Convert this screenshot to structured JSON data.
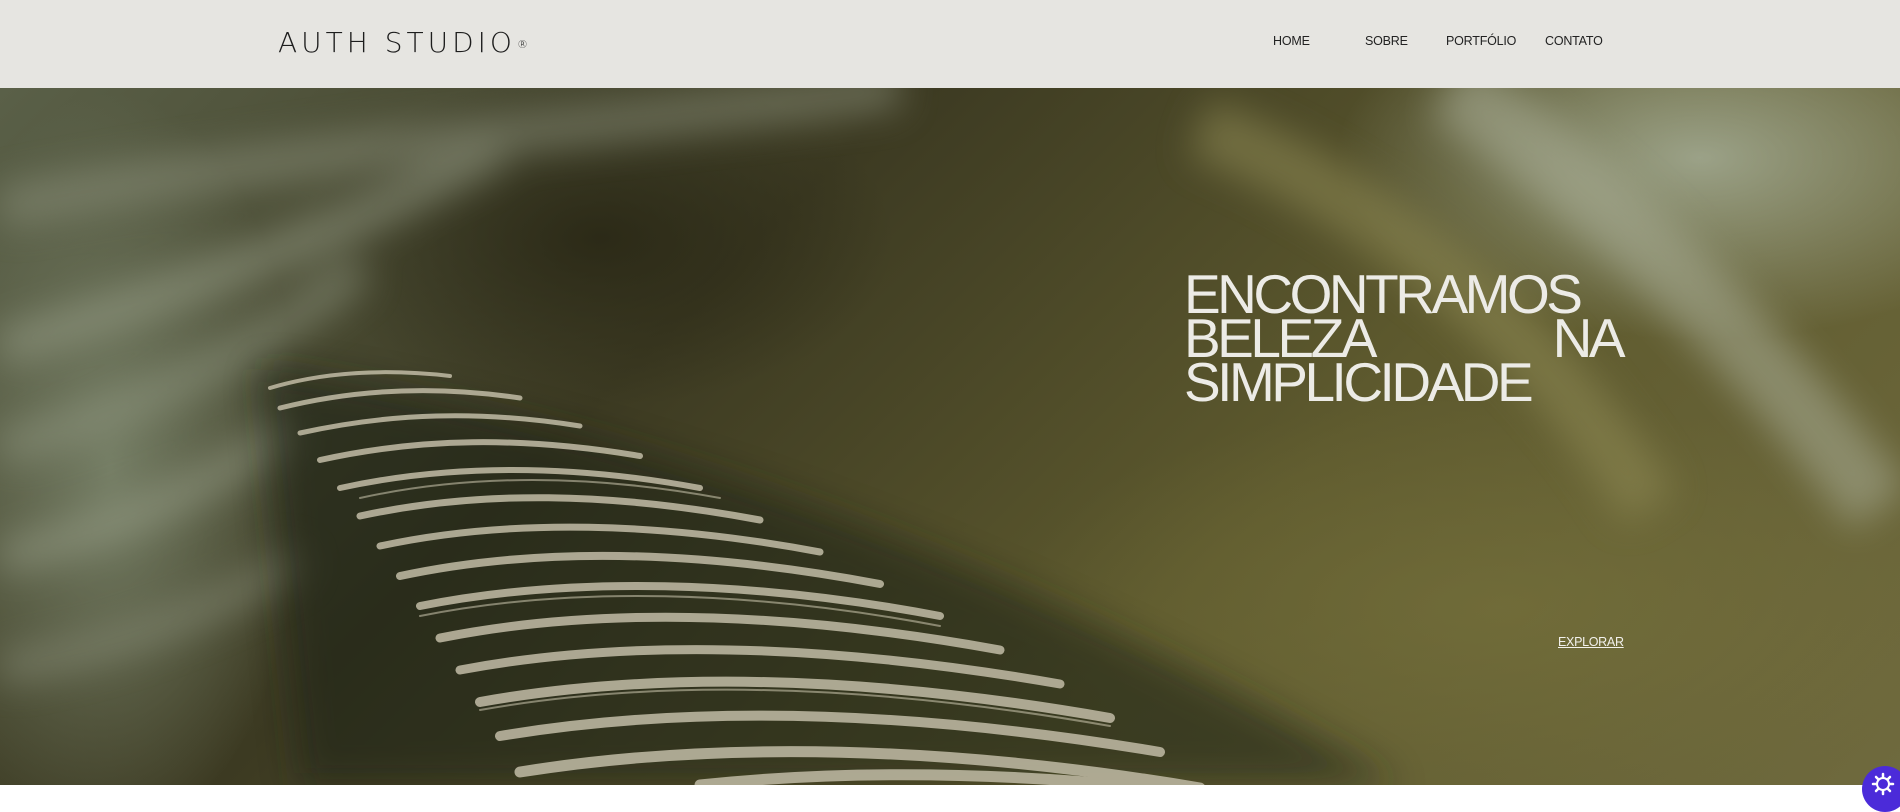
{
  "header": {
    "logo": "AUTH STUDIO",
    "logo_mark": "®"
  },
  "nav": {
    "items": [
      {
        "label": "HOME"
      },
      {
        "label": "SOBRE"
      },
      {
        "label": "PORTFÓLIO"
      },
      {
        "label": "CONTATO"
      }
    ]
  },
  "hero": {
    "headline_line1": "ENCONTRAMOS",
    "headline_line2_word1": "BELEZA",
    "headline_line2_word2": "NA",
    "headline_line3": "SIMPLICIDADE",
    "cta_label": "EXPLORAR"
  },
  "icons": {
    "badge_icon": "gear-icon"
  },
  "colors": {
    "header_bg": "#e6e5e1",
    "hero_text": "#ecebe6",
    "badge": "#4b2bd9"
  }
}
